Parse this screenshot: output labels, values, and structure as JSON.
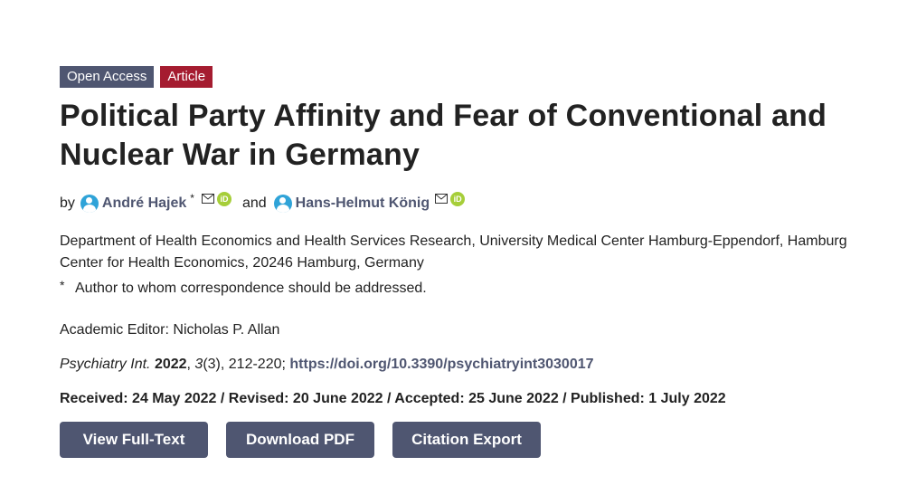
{
  "badges": {
    "open_access": "Open Access",
    "type": "Article"
  },
  "title_line1": "Political Party Affinity and Fear of Conventional and",
  "title_line2": "Nuclear War in Germany",
  "authors": {
    "by": "by",
    "and": "and",
    "star": "*",
    "list": [
      {
        "name": "André Hajek",
        "corresponding": true
      },
      {
        "name": "Hans-Helmut König",
        "corresponding": false
      }
    ]
  },
  "affiliation": "Department of Health Economics and Health Services Research, University Medical Center Hamburg-Eppendorf, Hamburg Center for Health Economics, 20246 Hamburg, Germany",
  "correspondence": {
    "symbol": "*",
    "text": "Author to whom correspondence should be addressed."
  },
  "editor": "Academic Editor: Nicholas P. Allan",
  "citation": {
    "journal": "Psychiatry Int.",
    "year": "2022",
    "volume": "3",
    "issue_pages": "(3), 212-220;",
    "doi": "https://doi.org/10.3390/psychiatryint3030017"
  },
  "dates": "Received: 24 May 2022 / Revised: 20 June 2022 / Accepted: 25 June 2022 / Published: 1 July 2022",
  "buttons": {
    "full_text": "View Full-Text",
    "pdf": "Download PDF",
    "citation": "Citation Export"
  },
  "colors": {
    "primary": "#4f5671",
    "article": "#a51c30",
    "author_icon": "#2fa3d8",
    "orcid": "#a6ce39"
  },
  "icons": {
    "author": "user-circle-icon",
    "mail": "mail-icon",
    "orcid": "orcid-icon"
  }
}
